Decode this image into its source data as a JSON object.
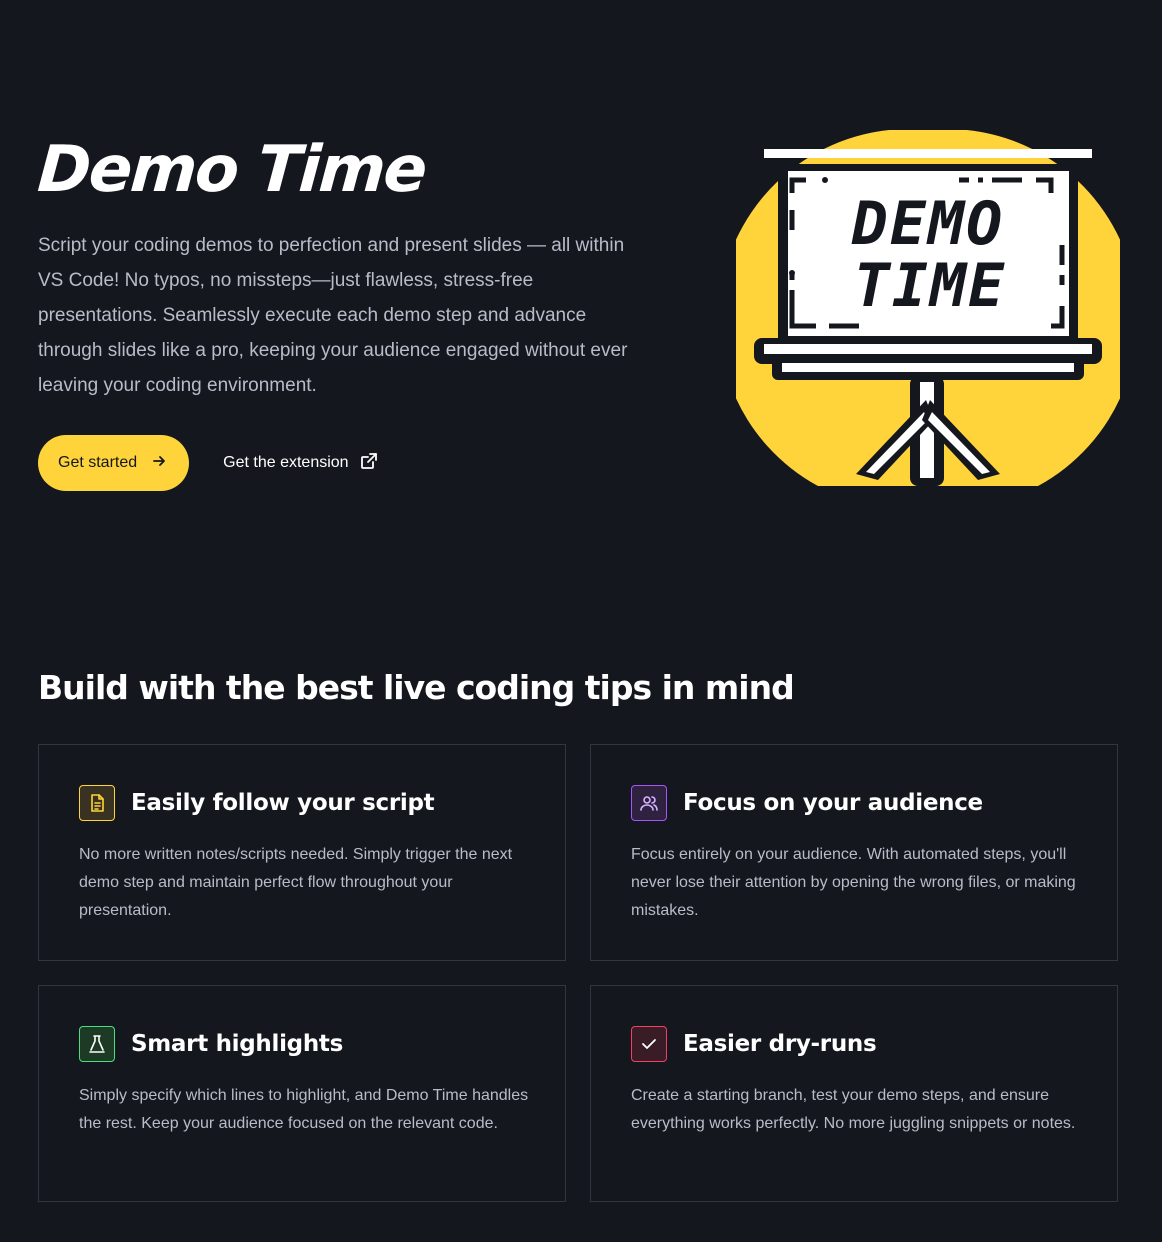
{
  "hero": {
    "title": "Demo Time",
    "description": "Script your coding demos to perfection and present slides — all within VS Code! No typos, no missteps—just flawless, stress-free presentations. Seamlessly execute each demo step and advance through slides like a pro, keeping your audience engaged without ever leaving your coding environment.",
    "primary_button": "Get started",
    "secondary_link": "Get the extension",
    "illustration_text_line1": "DEMO",
    "illustration_text_line2": "TIME"
  },
  "features": {
    "title": "Build with the best live coding tips in mind",
    "cards": [
      {
        "title": "Easily follow your script",
        "text": "No more written notes/scripts needed. Simply trigger the next demo step and maintain perfect flow throughout your presentation.",
        "icon": "document-icon",
        "color": "#ffd43b"
      },
      {
        "title": "Focus on your audience",
        "text": "Focus entirely on your audience. With automated steps, you'll never lose their attention by opening the wrong files, or making mistakes.",
        "icon": "users-icon",
        "color": "#a855f7"
      },
      {
        "title": "Smart highlights",
        "text": "Simply specify which lines to highlight, and Demo Time handles the rest. Keep your audience focused on the relevant code.",
        "icon": "highlighter-icon",
        "color": "#4ade80"
      },
      {
        "title": "Easier dry-runs",
        "text": "Create a starting branch, test your demo steps, and ensure everything works perfectly. No more juggling snippets or notes.",
        "icon": "check-icon",
        "color": "#f43f5e"
      }
    ]
  },
  "colors": {
    "background": "#15171f",
    "accent": "#ffd43b"
  }
}
